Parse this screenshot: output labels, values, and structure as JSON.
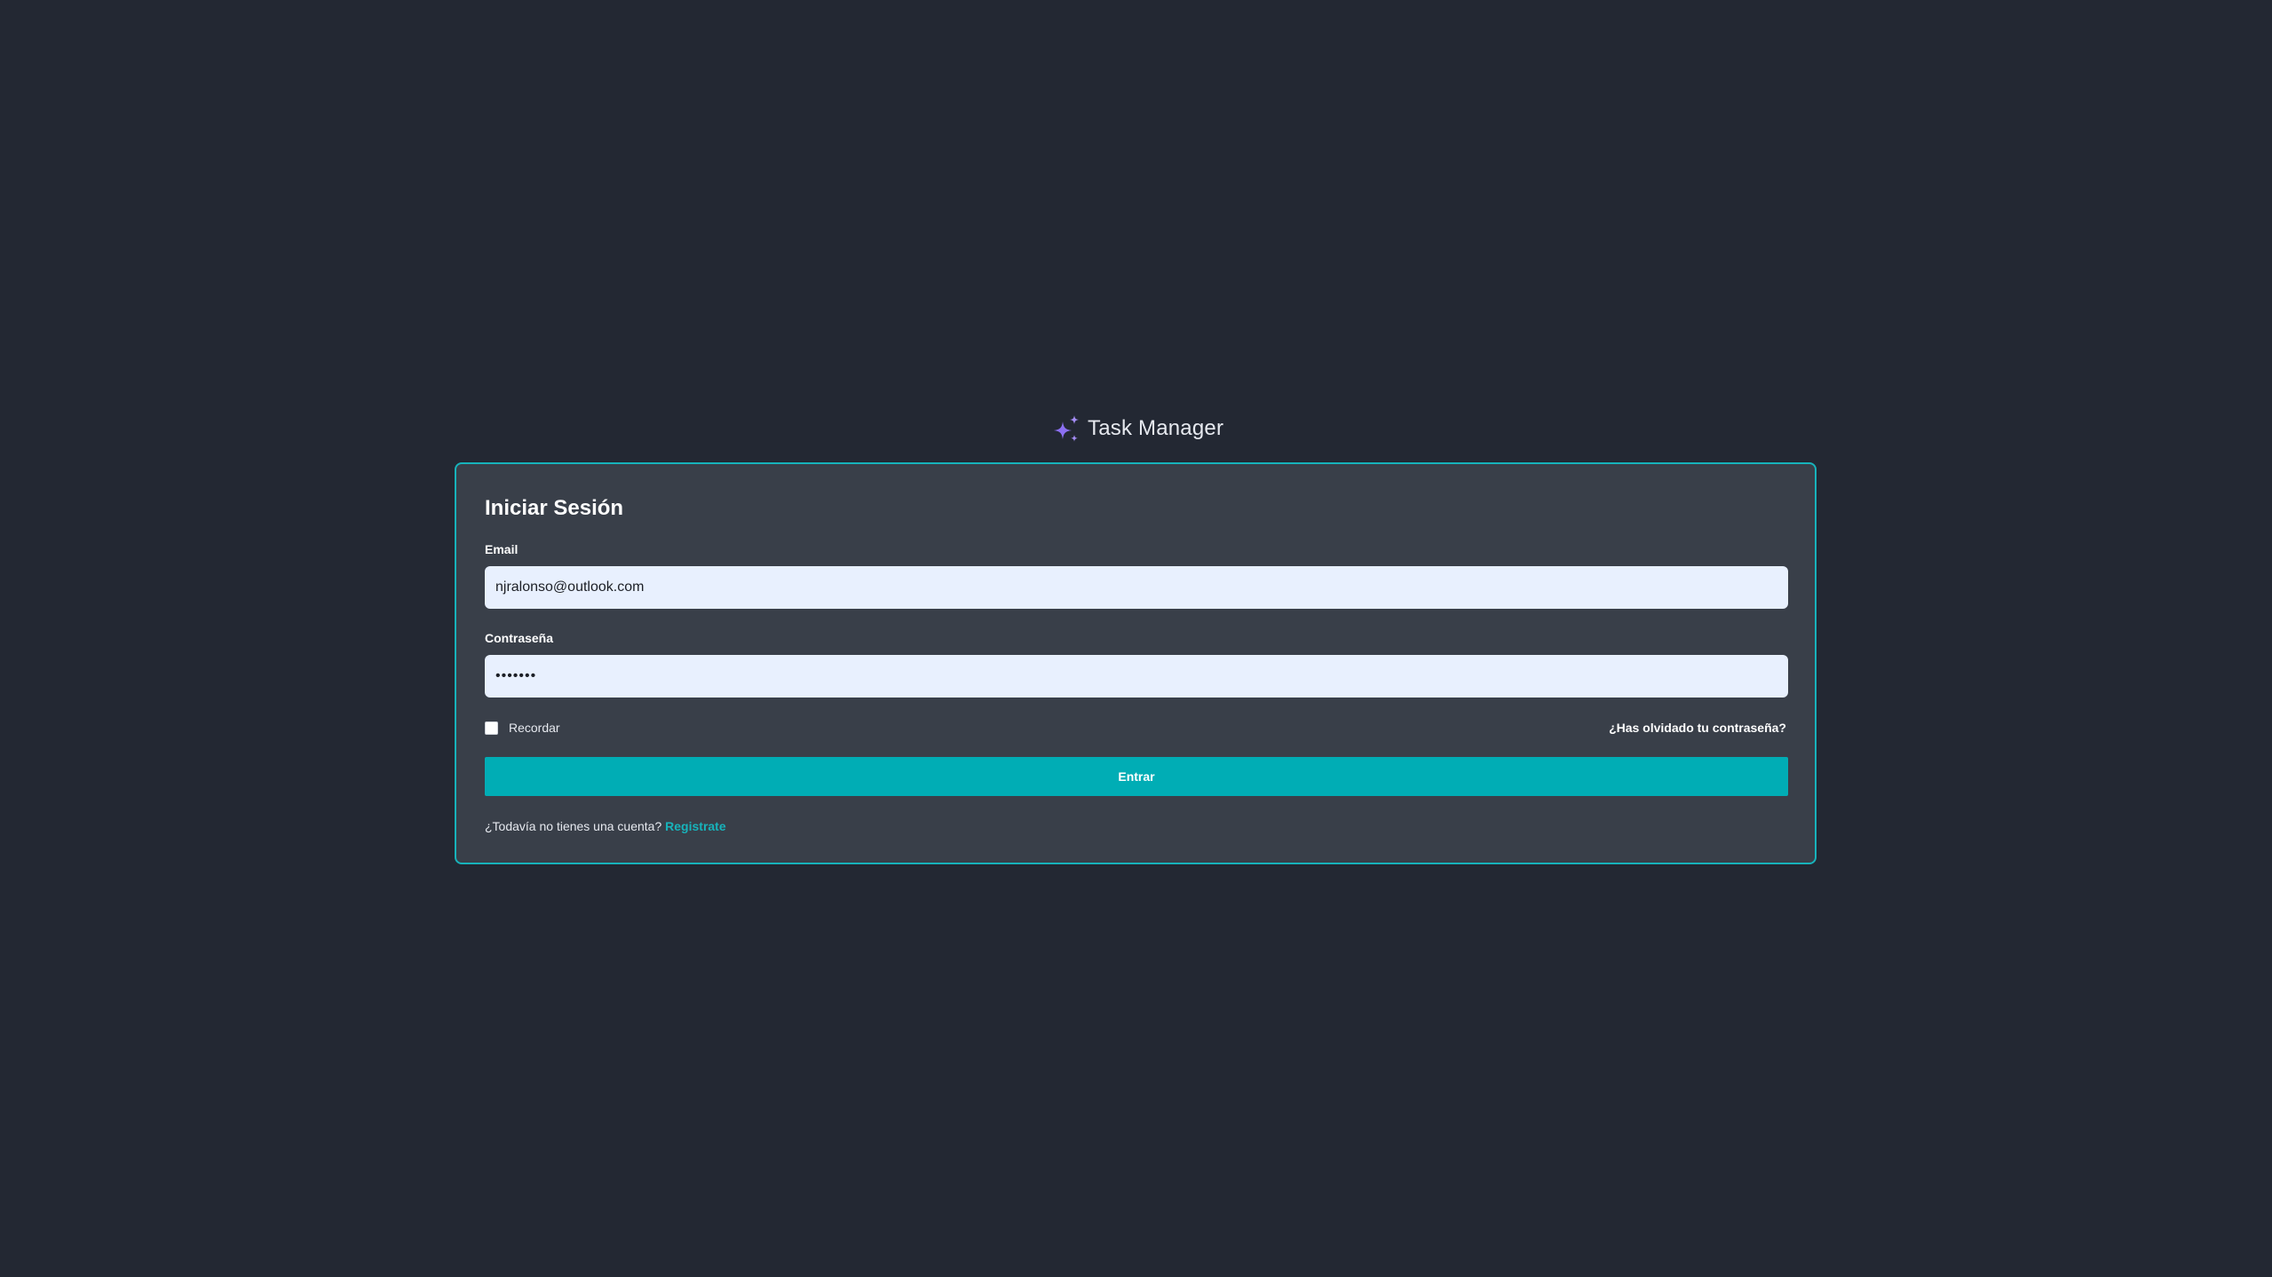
{
  "brand": {
    "icon": "sparkles-icon",
    "icon_color": "#8b6ff2",
    "title": "Task Manager"
  },
  "login": {
    "title": "Iniciar Sesión",
    "email": {
      "label": "Email",
      "value": "njralonso@outlook.com"
    },
    "password": {
      "label": "Contraseña",
      "value": "•••••••"
    },
    "remember": {
      "label": "Recordar",
      "checked": false
    },
    "forgot_link": "¿Has olvidado tu contraseña?",
    "submit_label": "Entrar",
    "register_prompt": "¿Todavía no tienes una cuenta?",
    "register_link": "Registrate"
  },
  "colors": {
    "background": "#232833",
    "card": "#393f49",
    "accent": "#00adb5",
    "input_background": "#e8f0fe"
  }
}
